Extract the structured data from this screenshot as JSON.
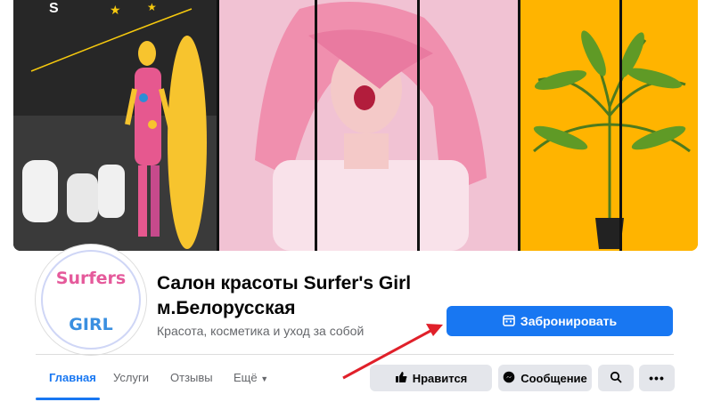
{
  "page": {
    "title": "Салон красоты Surfer's Girl м.Белорусская",
    "category": "Красота, косметика и уход за собой",
    "avatar_text_top": "Surfers",
    "avatar_text_bottom": "GIRL"
  },
  "actions": {
    "book_label": "Забронировать",
    "like_label": "Нравится",
    "message_label": "Сообщение"
  },
  "tabs": [
    {
      "label": "Главная",
      "active": true
    },
    {
      "label": "Услуги"
    },
    {
      "label": "Отзывы"
    },
    {
      "label": "Ещё"
    }
  ],
  "icons": {
    "book": "calendar-icon",
    "like": "thumbs-up-icon",
    "message": "messenger-icon",
    "search": "search-icon",
    "more": "more-dots-icon",
    "tab_more": "caret-down-icon"
  },
  "colors": {
    "accent": "#1877f2",
    "arrow": "#e0202a",
    "cover_pink": "#f2bfd3",
    "cover_yellow": "#ffb800"
  }
}
